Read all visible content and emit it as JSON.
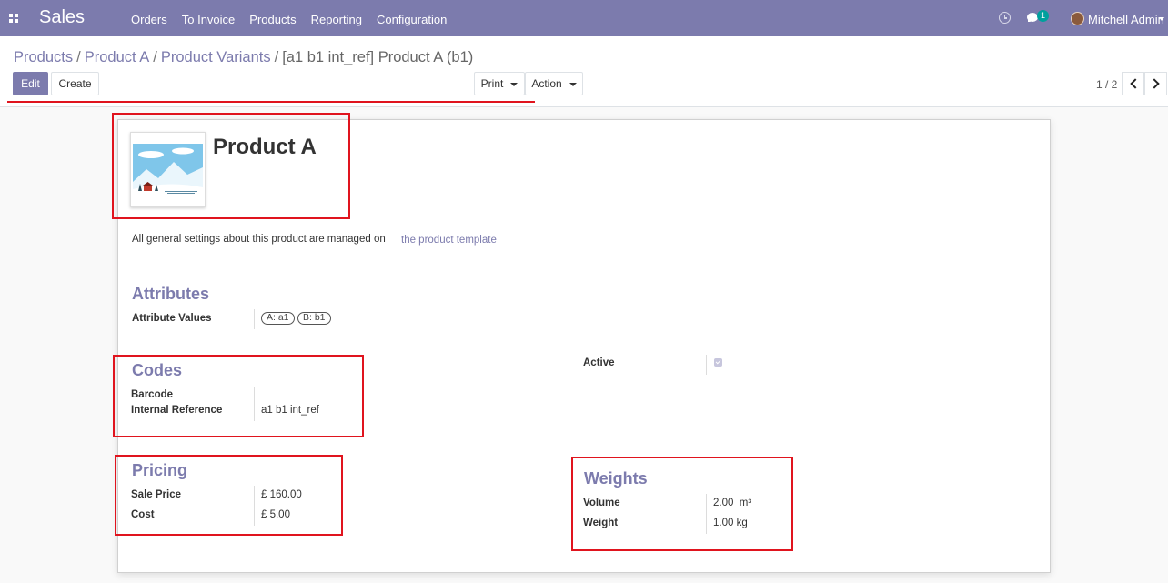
{
  "navbar": {
    "app_name": "Sales",
    "menu": [
      "Orders",
      "To Invoice",
      "Products",
      "Reporting",
      "Configuration"
    ],
    "notification_count": "1",
    "user_name": "Mitchell Admin"
  },
  "breadcrumb": [
    "Products",
    "Product A",
    "Product Variants",
    "[a1 b1 int_ref] Product A (b1)"
  ],
  "breadcrumb_separator": "/",
  "buttons": {
    "edit": "Edit",
    "create": "Create",
    "print": "Print",
    "action": "Action"
  },
  "pager": {
    "value": "1 / 2"
  },
  "product": {
    "name": "Product A",
    "info_text": "All general settings about this product are managed on",
    "template_link": "the product template"
  },
  "attributes": {
    "title": "Attributes",
    "label": "Attribute Values",
    "tags": [
      "A: a1",
      "B: b1"
    ]
  },
  "codes": {
    "title": "Codes",
    "barcode_label": "Barcode",
    "barcode_value": "",
    "internal_ref_label": "Internal Reference",
    "internal_ref_value": "a1 b1 int_ref"
  },
  "active": {
    "label": "Active",
    "checked": true
  },
  "pricing": {
    "title": "Pricing",
    "sale_price_label": "Sale Price",
    "sale_price_value": "£ 160.00",
    "cost_label": "Cost",
    "cost_value": "£ 5.00"
  },
  "weights": {
    "title": "Weights",
    "volume_label": "Volume",
    "volume_value": "2.00",
    "volume_unit": "m³",
    "weight_label": "Weight",
    "weight_value": "1.00",
    "weight_unit": "kg"
  },
  "colors": {
    "brand": "#7c7bad",
    "annotation": "#e0141e"
  }
}
